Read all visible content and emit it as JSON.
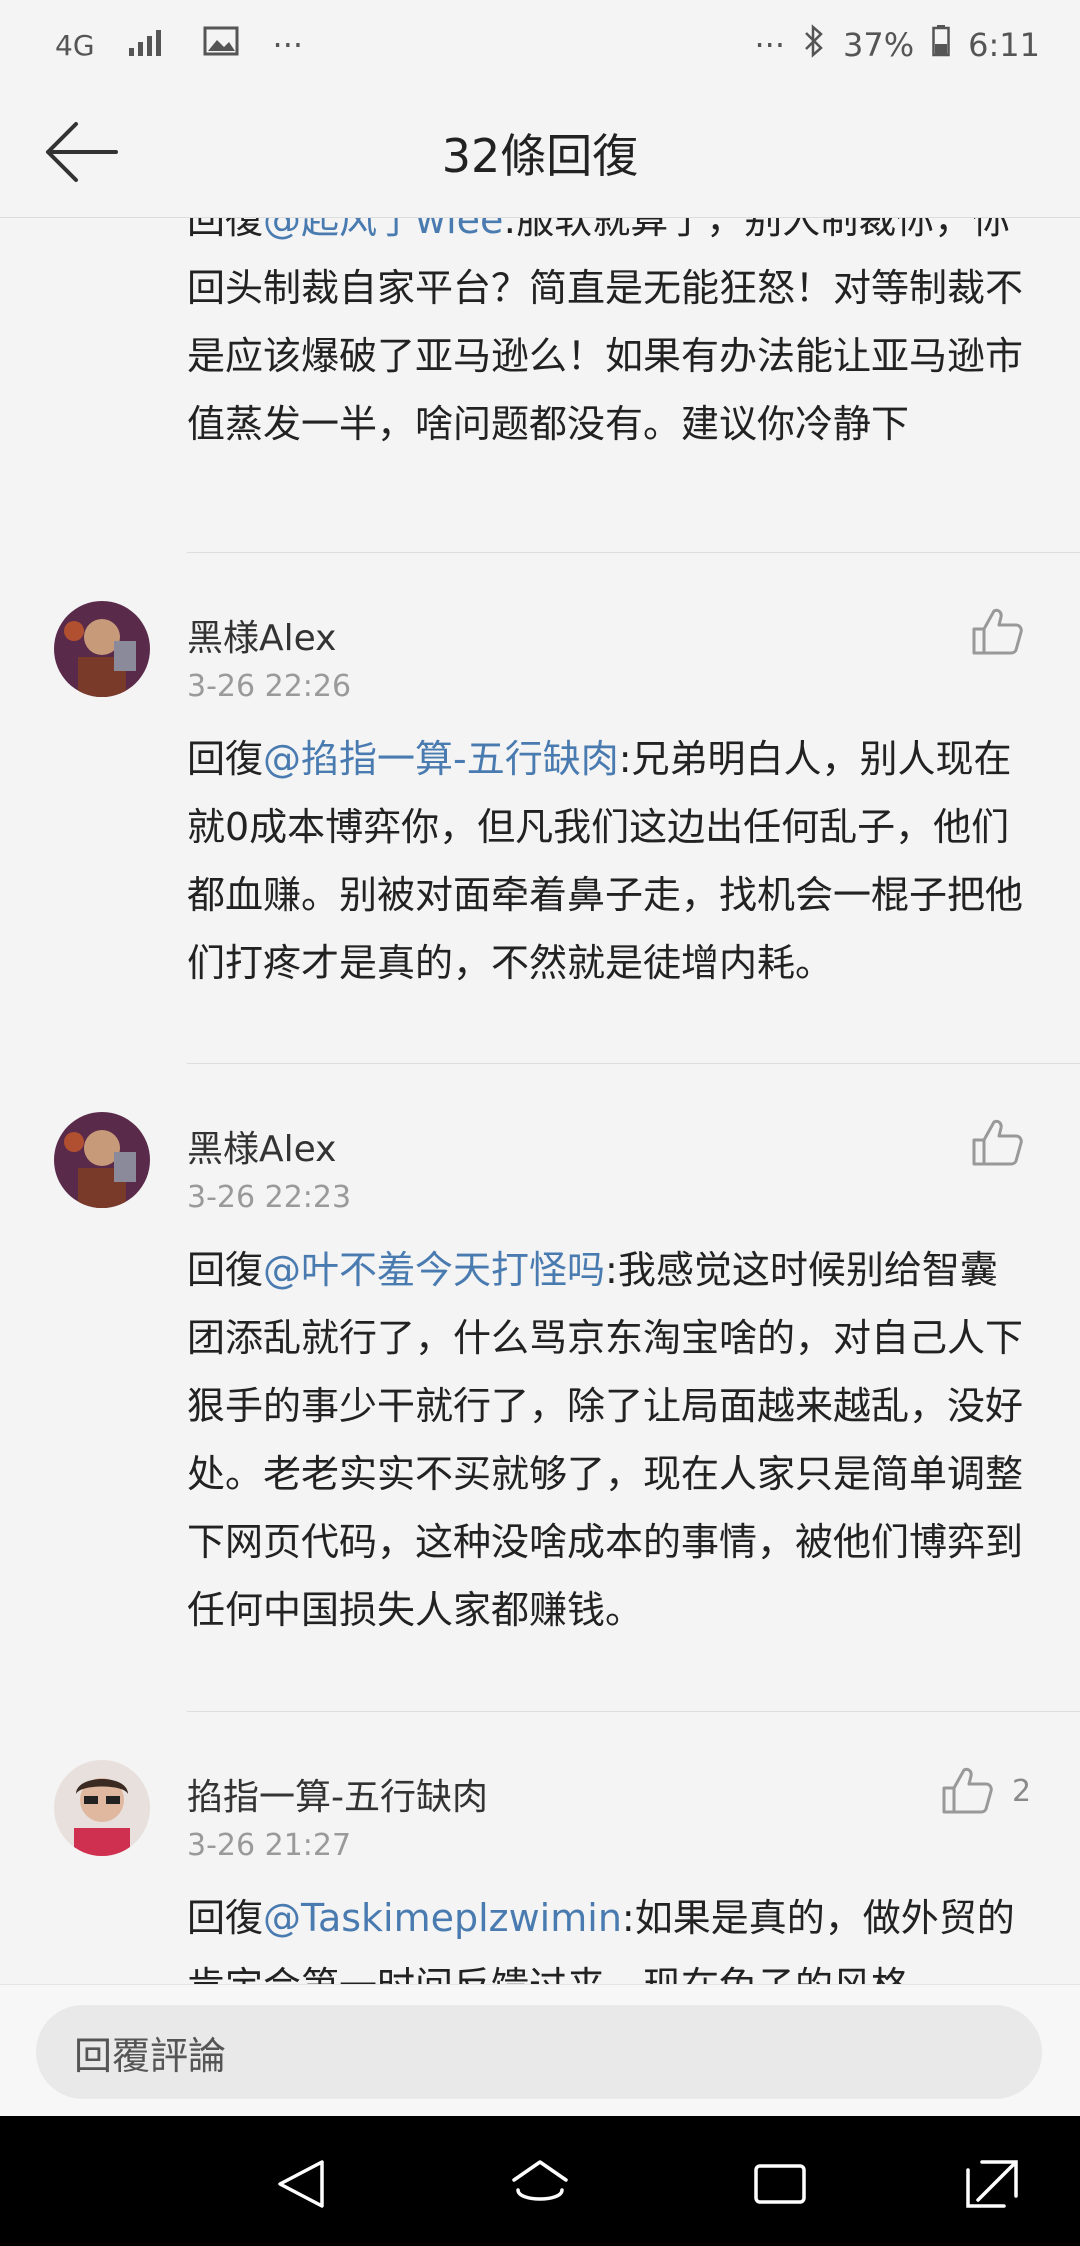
{
  "status_bar": {
    "network": "4G",
    "more": "···",
    "battery": "37%",
    "time": "6:11",
    "right_dots": "···"
  },
  "header": {
    "title": "32條回復",
    "back_icon": "arrow-left-icon"
  },
  "partial_comment": {
    "prefix": "回復",
    "mention": "@起风了wlee",
    "text": ":服软就算了，别人制裁你，你回头制裁自家平台？简直是无能狂怒！对等制裁不是应该爆破了亚马逊么！如果有办法能让亚马逊市值蒸发一半，啥问题都没有。建议你冷静下"
  },
  "comments": [
    {
      "name": "黑様Alex",
      "time": "3-26 22:26",
      "prefix": "回復",
      "mention": "@掐指一算-五行缺肉",
      "text": ":兄弟明白人，别人现在就0成本博弈你，但凡我们这边出任何乱子，他们都血赚。别被对面牵着鼻子走，找机会一棍子把他们打疼才是真的，不然就是徒增内耗。",
      "likes": ""
    },
    {
      "name": "黑様Alex",
      "time": "3-26 22:23",
      "prefix": "回復",
      "mention": "@叶不羞今天打怪吗",
      "text": ":我感觉这时候别给智囊团添乱就行了，什么骂京东淘宝啥的，对自己人下狠手的事少干就行了，除了让局面越来越乱，没好处。老老实实不买就够了，现在人家只是简单调整下网页代码，这种没啥成本的事情，被他们博弈到任何中国损失人家都赚钱。",
      "likes": ""
    },
    {
      "name": "掐指一算-五行缺肉",
      "time": "3-26 21:27",
      "prefix": "回復",
      "mention": "@Taskimeplzwimin",
      "text": ":如果是真的，做外贸的肯定会第一时间反馈过来，现在兔子的风格",
      "likes": "2"
    }
  ],
  "bottom": {
    "reply_placeholder": "回覆評論"
  },
  "colors": {
    "mention": "#4a7bb0",
    "background": "#f4f4f4",
    "nav_bar": "#000000"
  }
}
